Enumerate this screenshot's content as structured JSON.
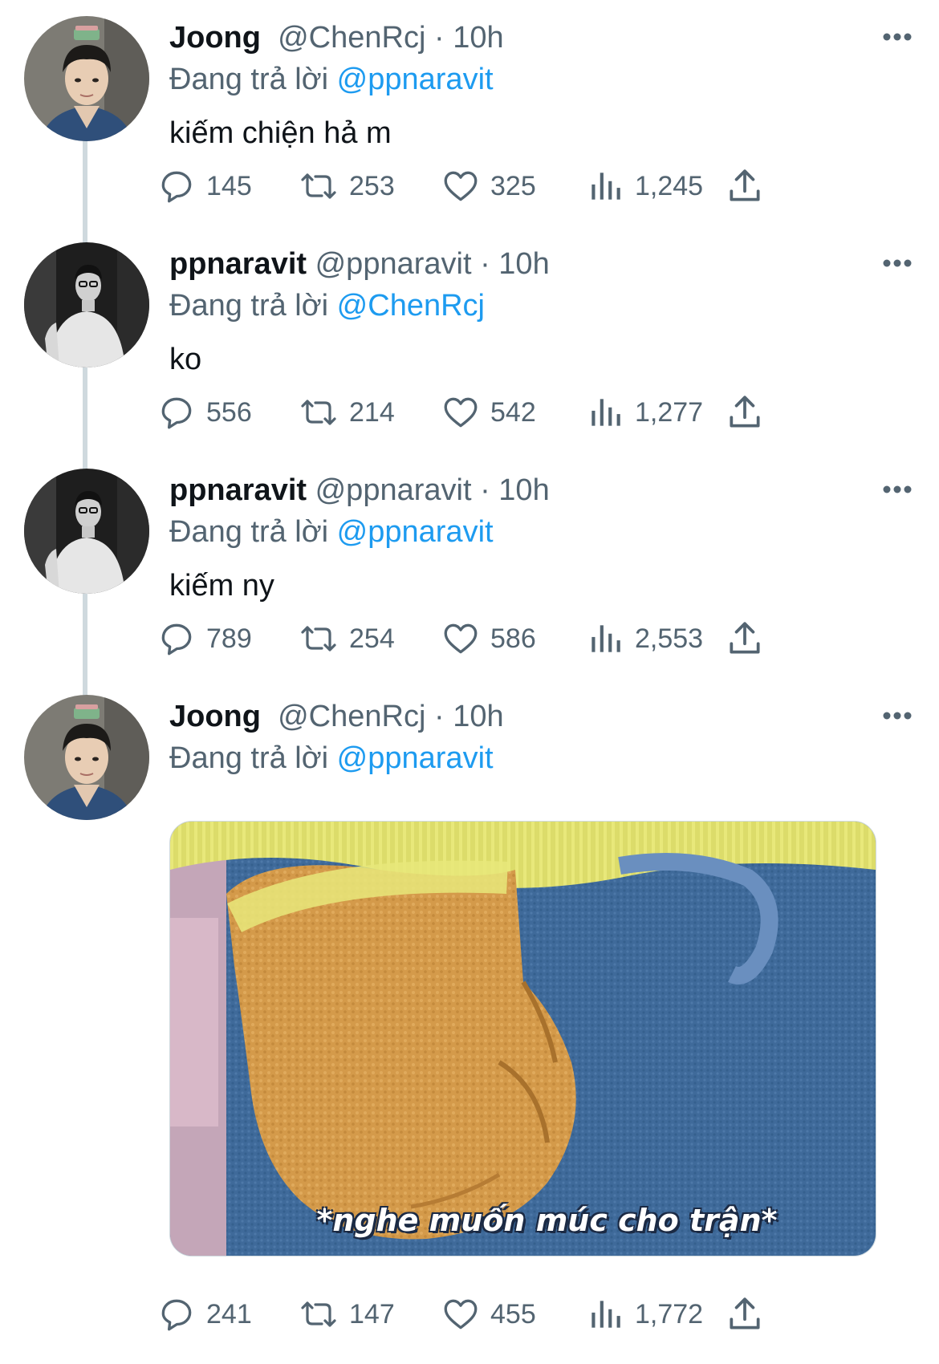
{
  "colors": {
    "text": "#0f1419",
    "secondary": "#536471",
    "link": "#1d9bf0",
    "thread_line": "#cfd9de"
  },
  "tweets": [
    {
      "name": "Joong",
      "handle": "@ChenRcj",
      "time": "10h",
      "replying_prefix": "Đang trả lời",
      "replying_to": "@ppnaravit",
      "text": "kiếm chiện hả m",
      "avatar": "joong-avatar",
      "stats": {
        "replies": "145",
        "retweets": "253",
        "likes": "325",
        "views": "1,245"
      }
    },
    {
      "name": "ppnaravit",
      "handle": "@ppnaravit",
      "time": "10h",
      "replying_prefix": "Đang trả lời",
      "replying_to": "@ChenRcj",
      "text": "ko",
      "avatar": "ppnaravit-avatar",
      "stats": {
        "replies": "556",
        "retweets": "214",
        "likes": "542",
        "views": "1,277"
      }
    },
    {
      "name": "ppnaravit",
      "handle": "@ppnaravit",
      "time": "10h",
      "replying_prefix": "Đang trả lời",
      "replying_to": "@ppnaravit",
      "text": "kiếm ny",
      "avatar": "ppnaravit-avatar",
      "stats": {
        "replies": "789",
        "retweets": "254",
        "likes": "586",
        "views": "2,553"
      }
    },
    {
      "name": "Joong",
      "handle": "@ChenRcj",
      "time": "10h",
      "replying_prefix": "Đang trả lời",
      "replying_to": "@ppnaravit",
      "media_caption": "*nghe muốn múc cho trận*",
      "avatar": "joong-avatar",
      "stats": {
        "replies": "241",
        "retweets": "147",
        "likes": "455",
        "views": "1,772"
      }
    }
  ],
  "separator": "·",
  "icons": {
    "reply": "speech-bubble-icon",
    "retweet": "retweet-arrows-icon",
    "like": "heart-icon",
    "views": "bar-chart-icon",
    "share": "share-upload-icon",
    "more": "more-dots-icon"
  }
}
